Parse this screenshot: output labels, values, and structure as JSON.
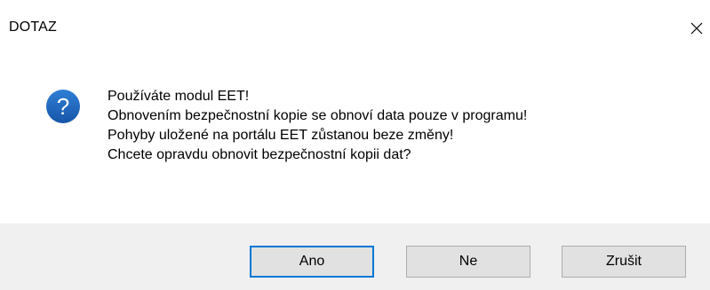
{
  "window": {
    "title": "DOTAZ",
    "close_glyph": "✕"
  },
  "icon": {
    "name": "question-icon",
    "glyph": "?",
    "color": "#1c63b7"
  },
  "message": {
    "lines": [
      "Používáte modul EET!",
      "Obnovením bezpečnostní kopie se obnoví data pouze v programu!",
      "Pohyby uložené na portálu EET zůstanou beze změny!",
      "Chcete opravdu obnovit bezpečnostní kopii dat?"
    ]
  },
  "buttons": {
    "yes_label": "Ano",
    "no_label": "Ne",
    "cancel_label": "Zrušit"
  },
  "colors": {
    "footer_bg": "#f0f0f0",
    "button_bg": "#e1e1e1",
    "focus_border": "#0078d7"
  }
}
